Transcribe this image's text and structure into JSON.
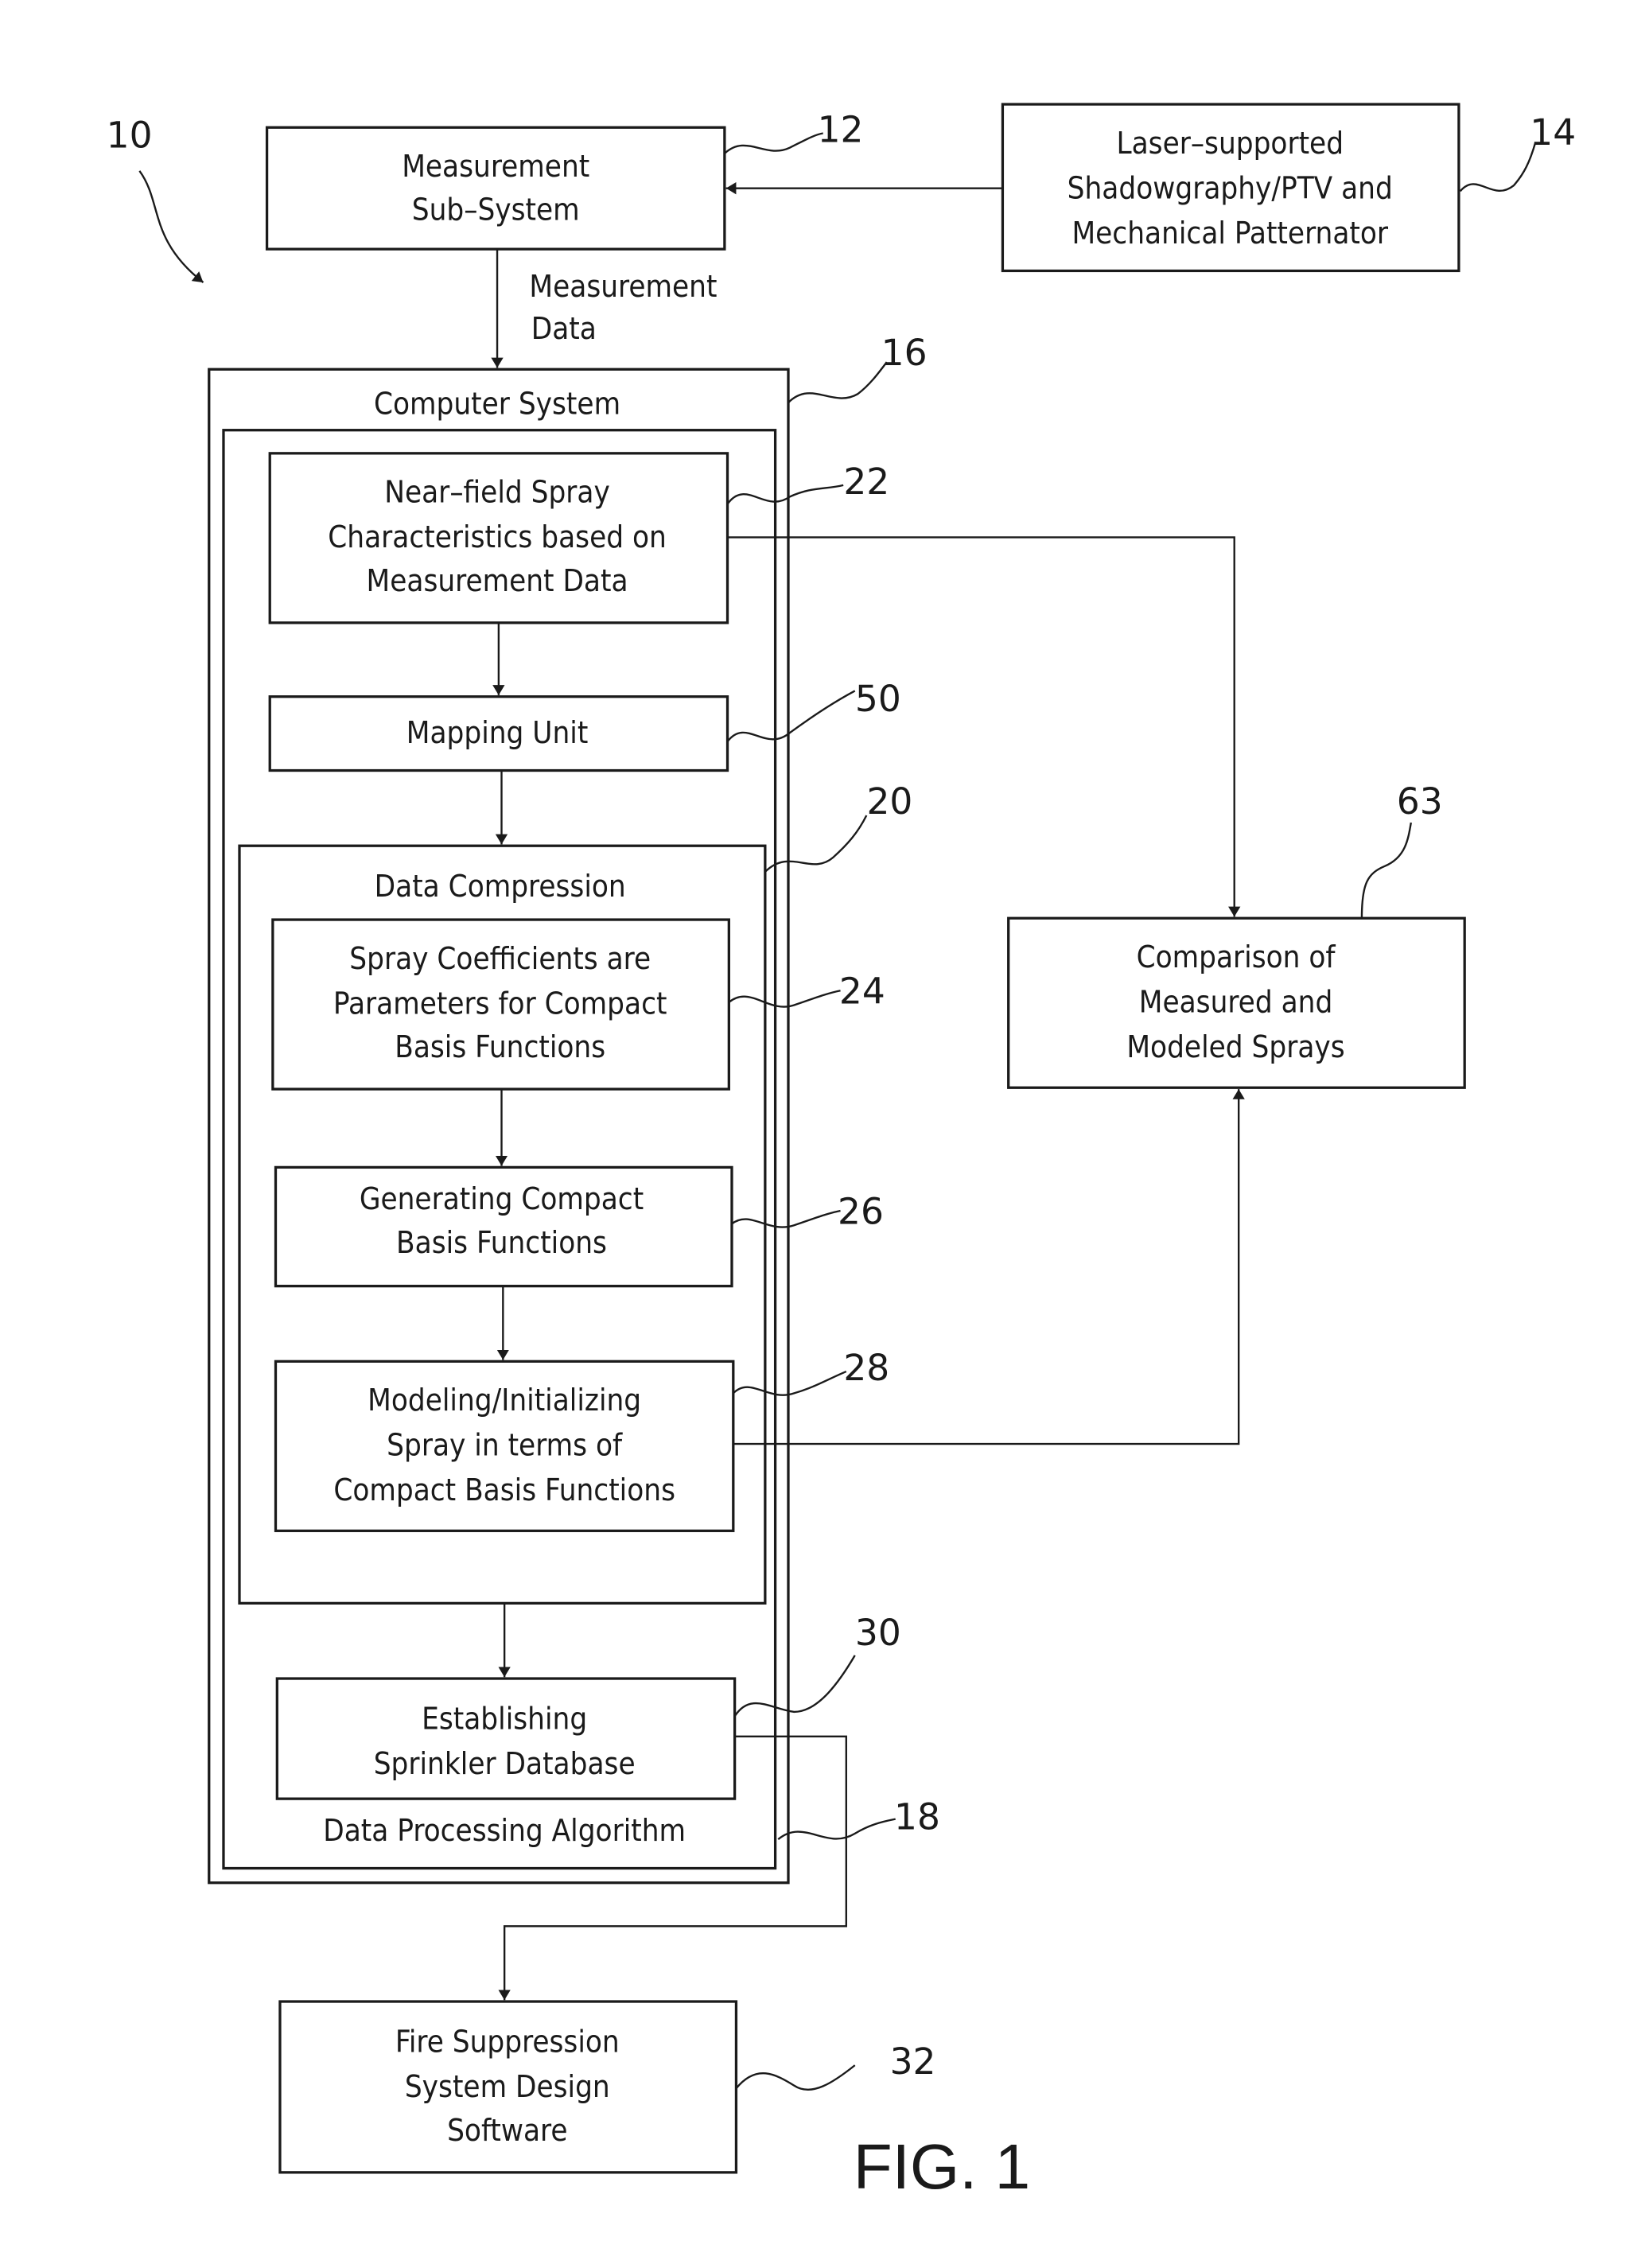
{
  "figure": {
    "title": "FIG. 1",
    "system_ref": "10"
  },
  "blocks": {
    "measurement": {
      "ref": "12",
      "lines": [
        "Measurement",
        "Sub–System"
      ]
    },
    "laser": {
      "ref": "14",
      "lines": [
        "Laser–supported",
        "Shadowgraphy/PTV and",
        "Mechanical Patternator"
      ]
    },
    "computer_system": {
      "ref": "16",
      "label": "Computer System"
    },
    "data_processing": {
      "ref": "18",
      "label": "Data Processing Algorithm"
    },
    "near_field": {
      "ref": "22",
      "lines": [
        "Near–field Spray",
        "Characteristics based on",
        "Measurement Data"
      ]
    },
    "mapping": {
      "ref": "50",
      "lines": [
        "Mapping Unit"
      ]
    },
    "data_compression": {
      "ref": "20",
      "label": "Data Compression"
    },
    "spray_coefficients": {
      "ref": "24",
      "lines": [
        "Spray Coefficients are",
        "Parameters for Compact",
        "Basis Functions"
      ]
    },
    "generating": {
      "ref": "26",
      "lines": [
        "Generating Compact",
        "Basis Functions"
      ]
    },
    "modeling": {
      "ref": "28",
      "lines": [
        "Modeling/Initializing",
        "Spray in terms of",
        "Compact Basis Functions"
      ]
    },
    "establishing": {
      "ref": "30",
      "lines": [
        "Establishing",
        "Sprinkler Database"
      ]
    },
    "comparison": {
      "ref": "63",
      "lines": [
        "Comparison of",
        "Measured and",
        "Modeled Sprays"
      ]
    },
    "fire_suppression": {
      "ref": "32",
      "lines": [
        "Fire Suppression",
        "System Design",
        "Software"
      ]
    }
  },
  "edges": {
    "measurement_data_label": [
      "Measurement",
      "Data"
    ]
  }
}
